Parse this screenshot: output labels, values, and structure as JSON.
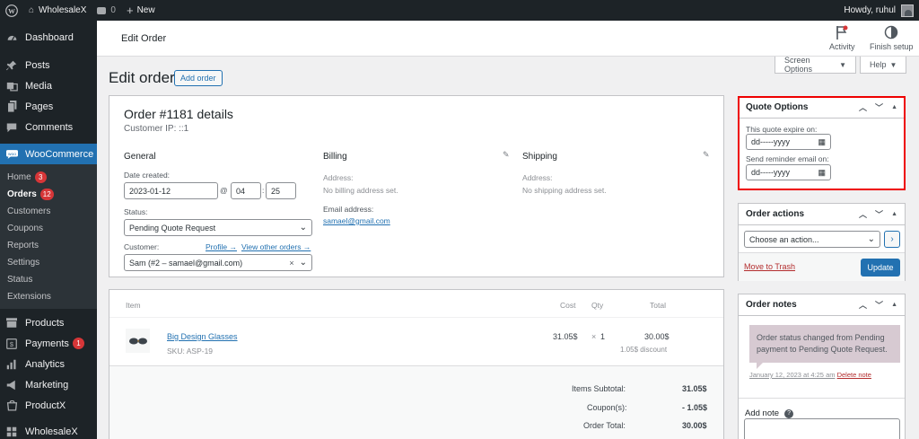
{
  "adminbar": {
    "site_name": "WholesaleX",
    "comments_count": "0",
    "new_label": "New",
    "howdy": "Howdy, ruhul"
  },
  "sidebar": {
    "items": [
      {
        "label": "Dashboard",
        "icon": "dashboard-icon"
      },
      {
        "label": "Posts",
        "icon": "pin-icon"
      },
      {
        "label": "Media",
        "icon": "media-icon"
      },
      {
        "label": "Pages",
        "icon": "pages-icon"
      },
      {
        "label": "Comments",
        "icon": "comments-icon"
      },
      {
        "label": "WooCommerce",
        "icon": "woo-icon"
      }
    ],
    "woo_sub": [
      {
        "label": "Home",
        "badge": "3"
      },
      {
        "label": "Orders",
        "badge": "12"
      },
      {
        "label": "Customers"
      },
      {
        "label": "Coupons"
      },
      {
        "label": "Reports"
      },
      {
        "label": "Settings"
      },
      {
        "label": "Status"
      },
      {
        "label": "Extensions"
      }
    ],
    "lower": [
      {
        "label": "Products",
        "icon": "products-icon"
      },
      {
        "label": "Payments",
        "icon": "payments-icon",
        "badge": "1"
      },
      {
        "label": "Analytics",
        "icon": "analytics-icon"
      },
      {
        "label": "Marketing",
        "icon": "megaphone-icon"
      },
      {
        "label": "ProductX",
        "icon": "productx-icon"
      },
      {
        "label": "WholesaleX",
        "icon": "wholesalex-icon"
      }
    ]
  },
  "header": {
    "title": "Edit Order",
    "activity_label": "Activity",
    "finish_setup_label": "Finish setup",
    "screen_options_label": "Screen Options",
    "help_label": "Help"
  },
  "page": {
    "title": "Edit order",
    "add_order_label": "Add order"
  },
  "order": {
    "title": "Order #1181 details",
    "customer_ip": "Customer IP: ::1",
    "general": {
      "heading": "General",
      "date_label": "Date created:",
      "date_value": "2023-01-12",
      "at": "@",
      "hour": "04",
      "colon": ":",
      "minute": "25",
      "status_label": "Status:",
      "status_value": "Pending Quote Request",
      "customer_label": "Customer:",
      "profile_link": "Profile →",
      "other_orders_link": "View other orders →",
      "customer_value": "Sam (#2 – samael@gmail.com)"
    },
    "billing": {
      "heading": "Billing",
      "address_label": "Address:",
      "address_value": "No billing address set.",
      "email_label": "Email address:",
      "email_value": "samael@gmail.com"
    },
    "shipping": {
      "heading": "Shipping",
      "address_label": "Address:",
      "address_value": "No shipping address set."
    }
  },
  "items": {
    "headers": {
      "item": "Item",
      "cost": "Cost",
      "qty": "Qty",
      "total": "Total"
    },
    "rows": [
      {
        "name": "Big Design Glasses",
        "sku": "SKU: ASP-19",
        "cost": "31.05$",
        "qty_x": "×",
        "qty": "1",
        "total": "30.00$",
        "discount": "1.05$ discount"
      }
    ],
    "totals": [
      {
        "label": "Items Subtotal:",
        "value": "31.05$"
      },
      {
        "label": "Coupon(s):",
        "value": "- 1.05$"
      },
      {
        "label": "Order Total:",
        "value": "30.00$"
      }
    ]
  },
  "quote_options": {
    "title": "Quote Options",
    "expire_label": "This quote expire on:",
    "expire_placeholder": "dd-----yyyy",
    "reminder_label": "Send reminder email on:",
    "reminder_placeholder": "dd-----yyyy"
  },
  "order_actions": {
    "title": "Order actions",
    "select_value": "Choose an action...",
    "trash_label": "Move to Trash",
    "update_label": "Update"
  },
  "order_notes": {
    "title": "Order notes",
    "note_text": "Order status changed from Pending payment to Pending Quote Request.",
    "note_date": "January 12, 2023 at 4:25 am",
    "delete_label": "Delete note",
    "add_note_label": "Add note",
    "help_icon": "?"
  },
  "colors": {
    "admin_dark": "#1d2327",
    "accent": "#2271b1",
    "badge": "#d63638",
    "highlight": "#e00000"
  }
}
